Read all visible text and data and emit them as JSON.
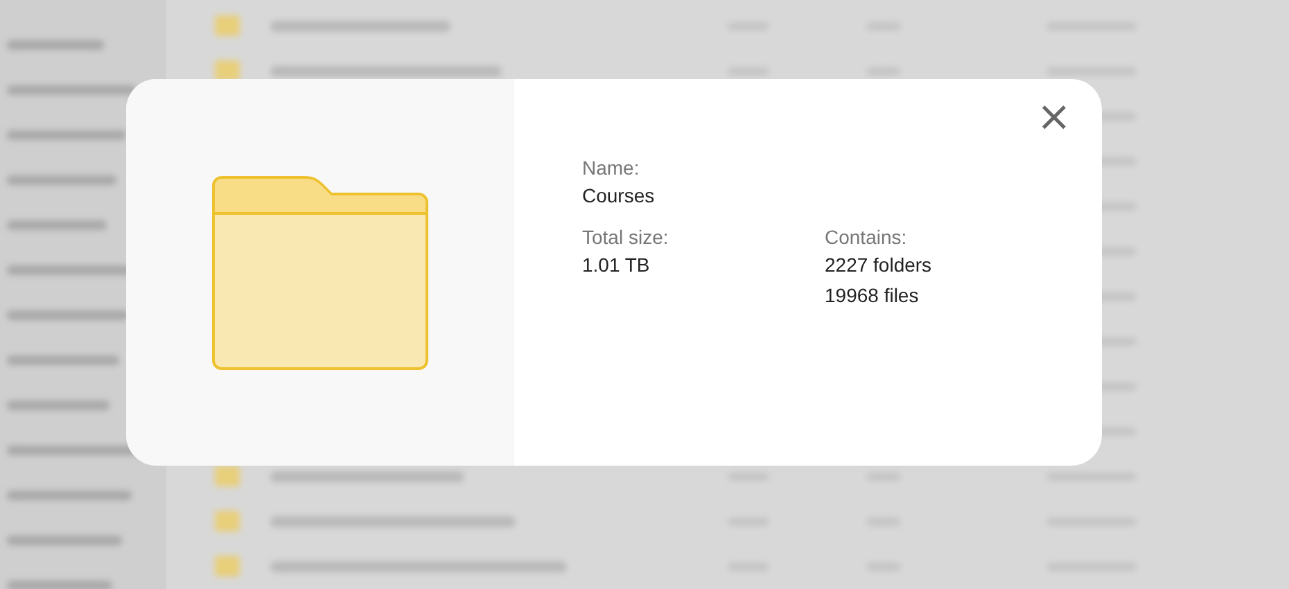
{
  "dialog": {
    "close": "×",
    "name_label": "Name:",
    "name": "Courses",
    "size_label": "Total size:",
    "size": "1.01 TB",
    "contains_label": "Contains:",
    "contains": [
      "2227 folders",
      "19968 files"
    ]
  }
}
